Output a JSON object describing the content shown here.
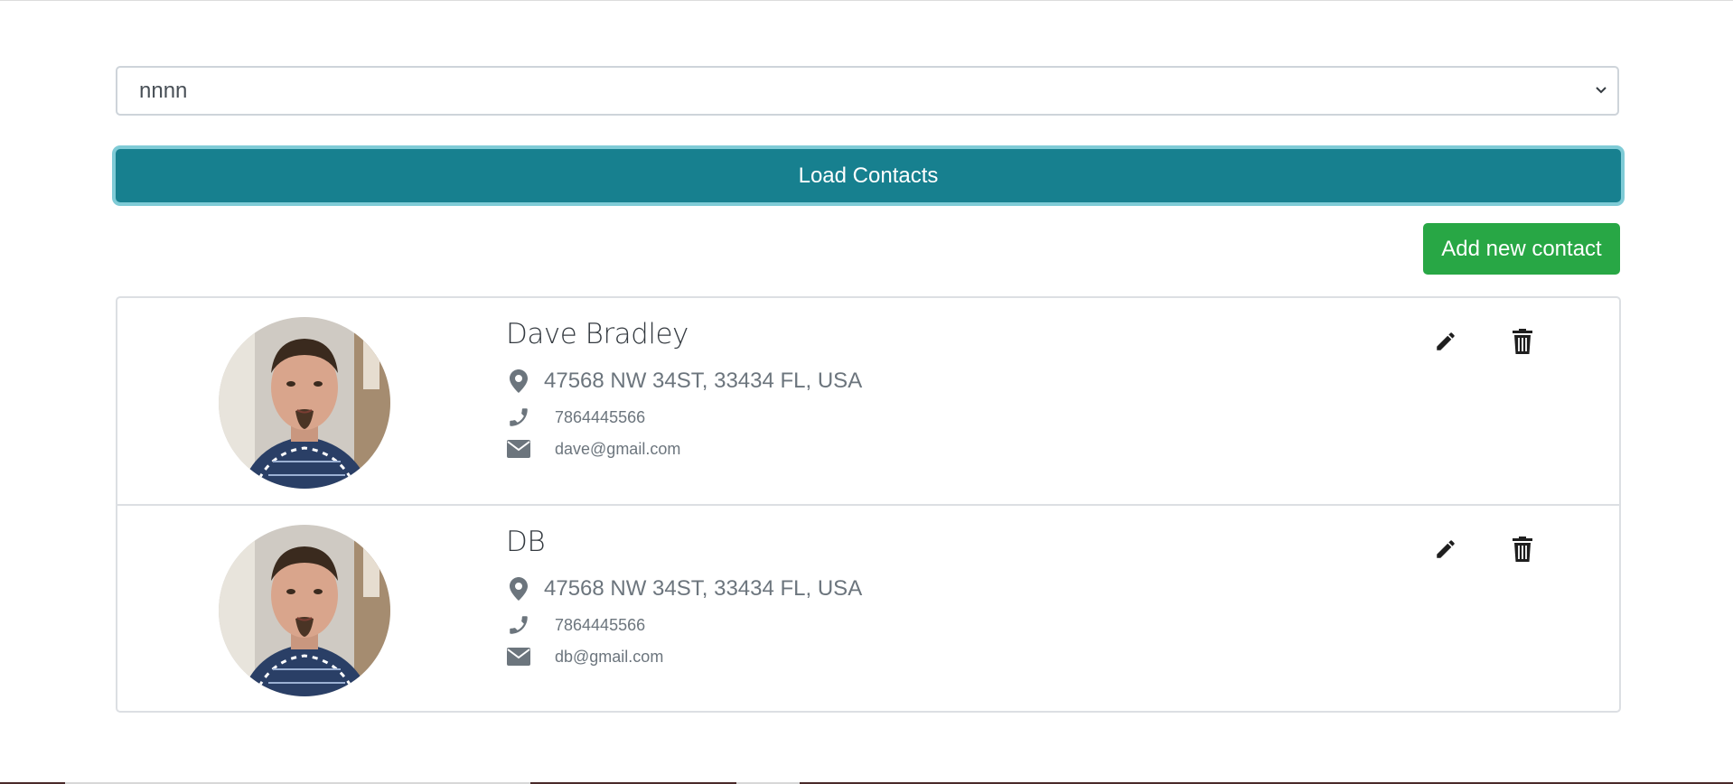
{
  "account_select": {
    "selected": "nnnn"
  },
  "buttons": {
    "load_contacts": "Load Contacts",
    "add_contact": "Add new contact"
  },
  "contacts": [
    {
      "name": "Dave Bradley",
      "address": "47568 NW 34ST, 33434 FL, USA",
      "phone": "7864445566",
      "email": "dave@gmail.com"
    },
    {
      "name": "DB",
      "address": "47568 NW 34ST, 33434 FL, USA",
      "phone": "7864445566",
      "email": "db@gmail.com"
    }
  ],
  "icons": {
    "address": "map-marker-icon",
    "phone": "phone-icon",
    "email": "envelope-icon",
    "edit": "pencil-icon",
    "delete": "trash-icon"
  },
  "colors": {
    "load_button": "#17808f",
    "add_button": "#28a745",
    "muted_text": "#6c757d"
  }
}
